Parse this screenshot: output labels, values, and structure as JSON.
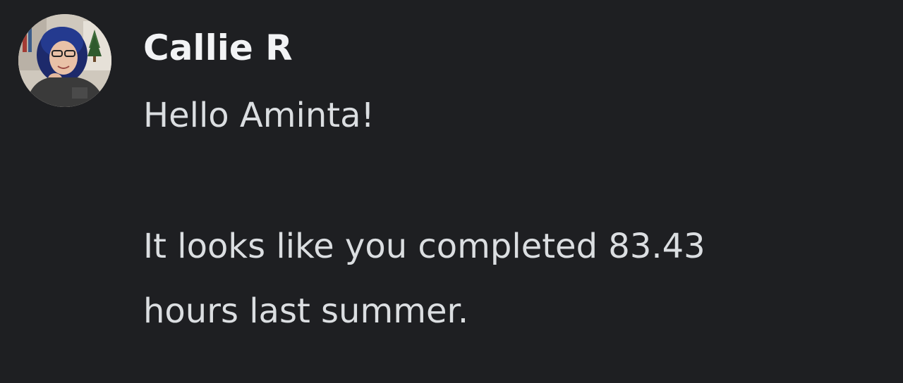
{
  "message": {
    "author": "Callie R",
    "avatar_icon": "user-avatar-photo",
    "lines": [
      "Hello Aminta!",
      "It looks like you completed 83.43",
      "hours last summer."
    ]
  },
  "colors": {
    "background": "#1e1f22",
    "author_text": "#f2f3f5",
    "body_text": "#dbdee1"
  }
}
